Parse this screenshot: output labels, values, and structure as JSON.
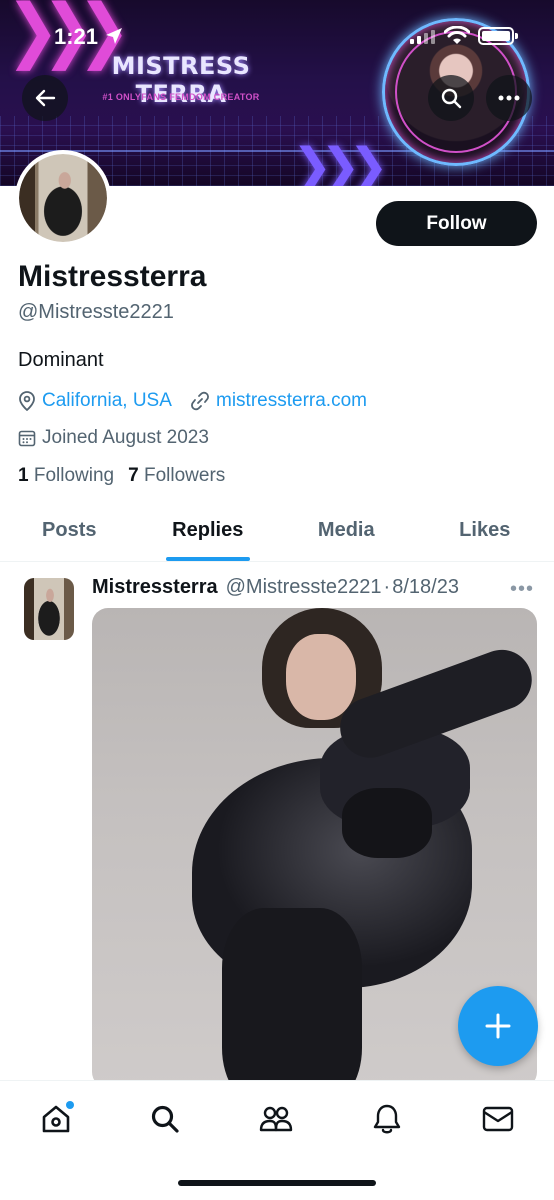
{
  "status_bar": {
    "time": "1:21"
  },
  "banner": {
    "title": "MISTRESS TERRA",
    "subtitle": "#1 ONLYFANS FEMDOM CREATOR"
  },
  "profile": {
    "follow_label": "Follow",
    "display_name": "Mistressterra",
    "handle": "@Mistresste2221",
    "bio": "Dominant",
    "location": "California, USA",
    "website": "mistressterra.com",
    "joined": "Joined August 2023",
    "following_count": "1",
    "following_label": "Following",
    "followers_count": "7",
    "followers_label": "Followers"
  },
  "tabs": [
    {
      "label": "Posts",
      "active": false
    },
    {
      "label": "Replies",
      "active": true
    },
    {
      "label": "Media",
      "active": false
    },
    {
      "label": "Likes",
      "active": false
    }
  ],
  "post": {
    "author_name": "Mistressterra",
    "author_handle": "@Mistresste2221",
    "separator": "·",
    "date": "8/18/23",
    "more": "•••"
  },
  "bottom_nav": {
    "items": [
      "home-icon",
      "search-icon",
      "communities-icon",
      "notifications-icon",
      "messages-icon"
    ]
  },
  "colors": {
    "accent": "#1d9bf0",
    "text_primary": "#0f1419",
    "text_secondary": "#536471",
    "follow_button": "#0f1419"
  }
}
